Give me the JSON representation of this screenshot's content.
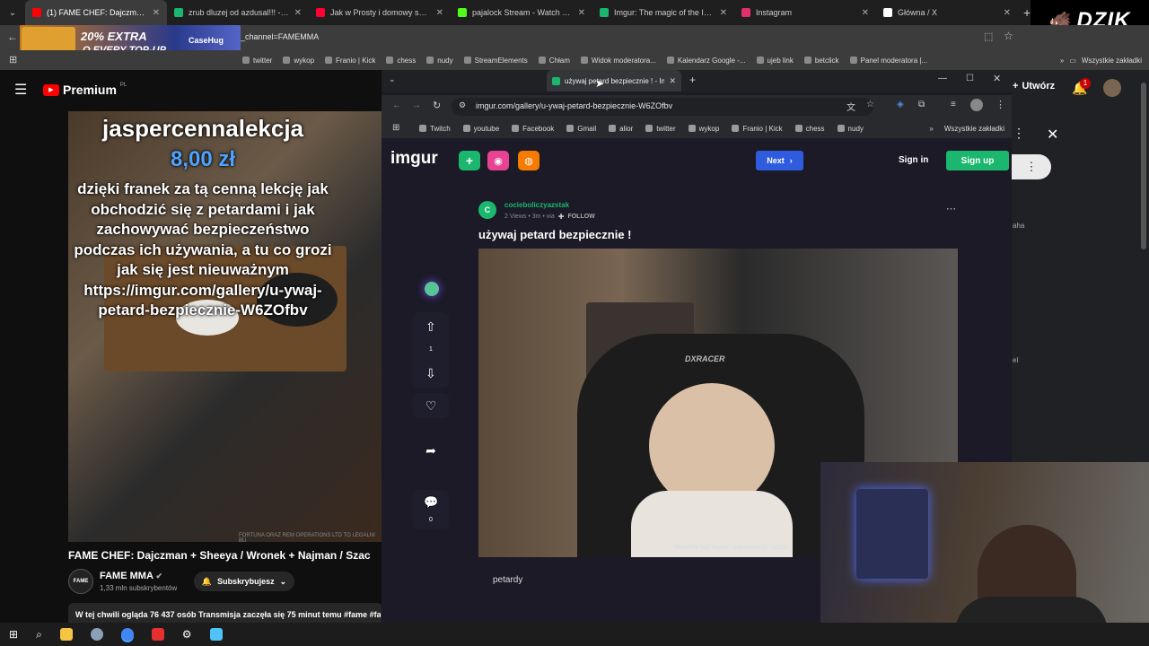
{
  "outer_tabs": [
    {
      "label": "(1) FAME CHEF: Dajczman + Sh",
      "color": "#ff0000",
      "active": true
    },
    {
      "label": "zrub dluzej od azdusal!!! - Img",
      "color": "#1bb76e",
      "active": false
    },
    {
      "label": "Jak w Prosty i domowy sposób",
      "color": "#ff0033",
      "active": false
    },
    {
      "label": "pajalock Stream - Watch Live o",
      "color": "#53fc18",
      "active": false
    },
    {
      "label": "Imgur: The magic of the Interne",
      "color": "#1bb76e",
      "active": false
    },
    {
      "label": "Instagram",
      "color": "#e1306c",
      "active": false
    },
    {
      "label": "Główna / X",
      "color": "#ffffff",
      "active": false
    }
  ],
  "outer_url": "_channel=FAMEMMA",
  "ad_text": {
    "line1": "20% EXTRA",
    "line2": "O EVERY TOP-UP",
    "brand": "CaseHug"
  },
  "dzik_logo": "DZIK",
  "outer_bookmarks": [
    "twitter",
    "wykop",
    "Franio | Kick",
    "chess",
    "nudy",
    "StreamElements",
    "Chłam",
    "Widok moderatora...",
    "Kalendarz Google -...",
    "ujeb link",
    "betclick",
    "Panel moderatora |..."
  ],
  "outer_bookmarks_all": "Wszystkie zakładki",
  "youtube": {
    "premium": "Premium",
    "premium_region": "PL",
    "create": "Utwórz",
    "notif_count": "1",
    "donation_user": "jaspercennalekcja",
    "donation_amount": "8,00 zł",
    "donation_message": "dzięki franek za tą cenną lekcję jak obchodzić się z petardami i jak zachowywać bezpieczeństwo podczas ich używania, a tu co grozi jak się jest nieuważnym https://imgur.com/gallery/u-ywaj-petard-bezpiecznie-W6ZOfbv",
    "video_watermark": "FORTUNA ORAZ REM OPERATIONS LTD TO LEGALNI BU",
    "title": "FAME CHEF: Dajczman + Sheeya / Wronek + Najman / Szac",
    "channel": "FAME MMA",
    "subscribers": "1,33 mln subskrybentów",
    "subscribe_label": "Subskrybujesz",
    "live_info": "W tej chwili ogląda 76 437 osób  Transmisja zaczęła się 75 minut temu  #fame #fa",
    "side_text_1": "aha",
    "side_text_2": "el"
  },
  "inner_tab": {
    "label": "używaj petard bezpiecznie ! - Im"
  },
  "inner_url": "imgur.com/gallery/u-ywaj-petard-bezpiecznie-W6ZOfbv",
  "inner_bookmarks": [
    "Twitch",
    "youtube",
    "Facebook",
    "Gmail",
    "alior",
    "twitter",
    "wykop",
    "Franio | Kick",
    "chess",
    "nudy"
  ],
  "inner_bookmarks_all": "Wszystkie zakładki",
  "imgur": {
    "logo": "imgur",
    "next": "Next",
    "sign_in": "Sign in",
    "sign_up": "Sign up",
    "author": "cocieboliczyazstak",
    "meta": "2 Views  •  3m  •  via",
    "follow": "FOLLOW",
    "post_title": "używaj petard bezpiecznie !",
    "vote_count": "1",
    "comment_count": "0",
    "description": "petardy",
    "stream_overlay": "Monthly top tipper: voldemort3 - zł120",
    "chair_brand": "DXRACER"
  },
  "colors": {
    "imgur_green": "#1bb76e",
    "imgur_bg": "#1b1a26",
    "next_blue": "#2f5cde",
    "yt_red": "#ff0000"
  }
}
